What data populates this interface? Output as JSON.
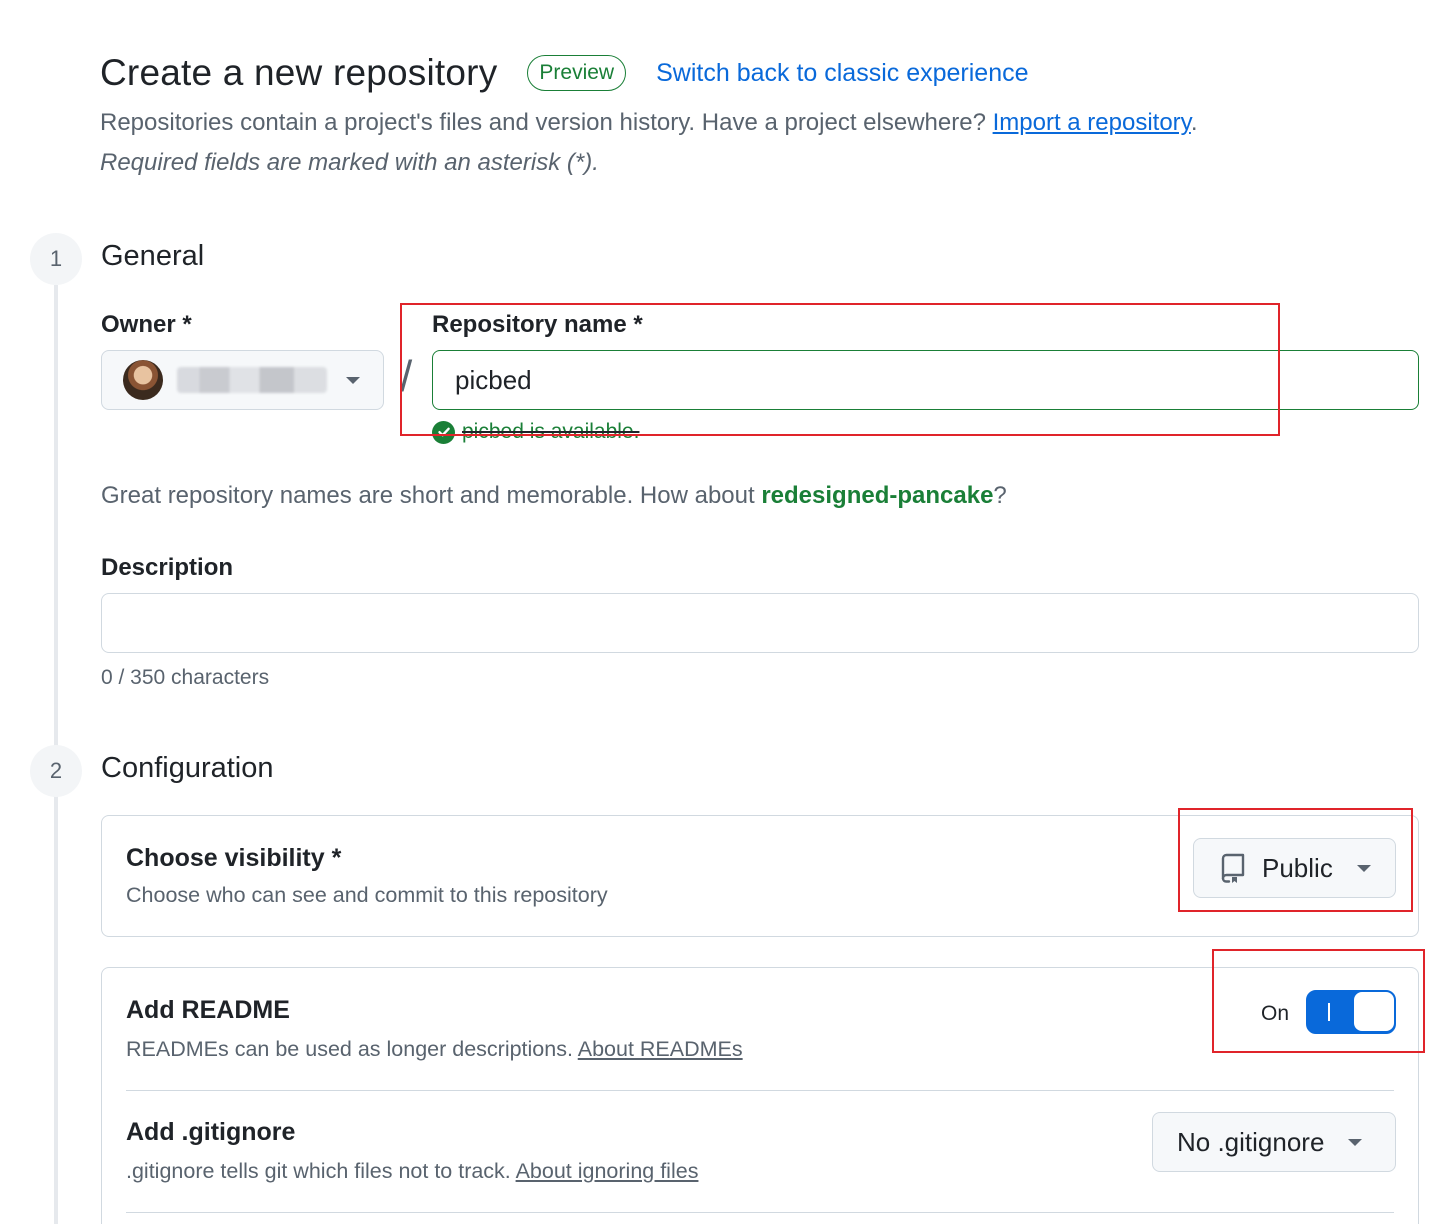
{
  "header": {
    "title": "Create a new repository",
    "badge": "Preview",
    "switch_link": "Switch back to classic experience"
  },
  "intro": {
    "text": "Repositories contain a project's files and version history. Have a project elsewhere? ",
    "import_link": "Import a repository",
    "trailing": ".",
    "required_note": "Required fields are marked with an asterisk (*)."
  },
  "steps": [
    {
      "number": "1",
      "title": "General"
    },
    {
      "number": "2",
      "title": "Configuration"
    }
  ],
  "general": {
    "owner_label": "Owner *",
    "repo_label": "Repository name *",
    "slash": "/",
    "repo_value": "picbed",
    "availability": "picbed is available.",
    "suggestion_prefix": "Great repository names are short and memorable. How about ",
    "suggestion_name": "redesigned-pancake",
    "suggestion_suffix": "?",
    "description_label": "Description",
    "description_value": "",
    "char_count": "0 / 350 characters"
  },
  "configuration": {
    "visibility": {
      "title": "Choose visibility *",
      "desc": "Choose who can see and commit to this repository",
      "button_label": "Public",
      "icon": "repo-icon"
    },
    "readme": {
      "title": "Add README",
      "desc": "READMEs can be used as longer descriptions. ",
      "link": "About READMEs",
      "toggle_state": "On",
      "enabled": true
    },
    "gitignore": {
      "title": "Add .gitignore",
      "desc": ".gitignore tells git which files not to track. ",
      "link": "About ignoring files",
      "button_label": "No .gitignore"
    }
  },
  "colors": {
    "accent": "#0969da",
    "success": "#1a7f37",
    "annotation": "#e0242a"
  }
}
